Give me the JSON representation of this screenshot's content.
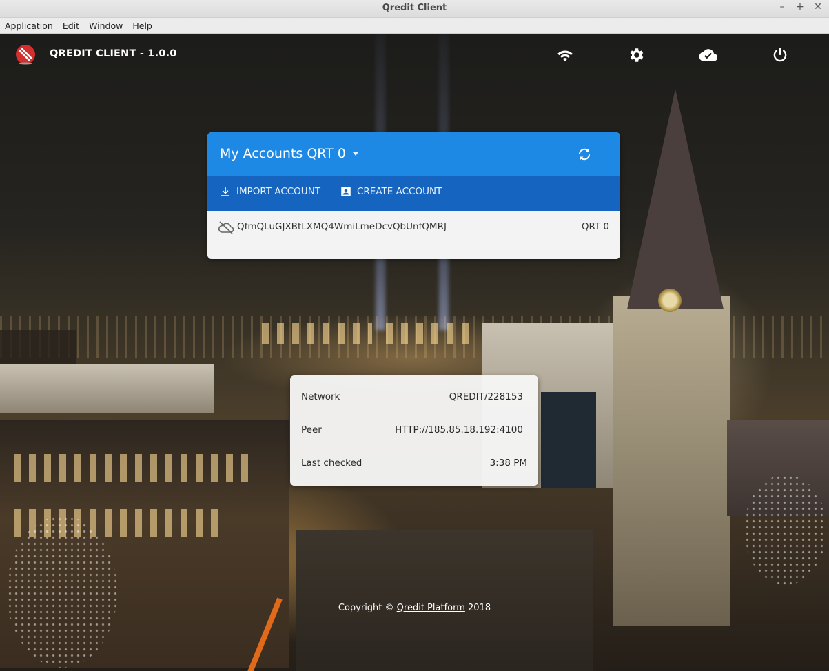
{
  "window": {
    "title": "Qredit Client",
    "controls": {
      "minimize": "–",
      "maximize": "+",
      "close": "✕"
    }
  },
  "menubar": {
    "items": [
      {
        "label": "Application"
      },
      {
        "label": "Edit"
      },
      {
        "label": "Window"
      },
      {
        "label": "Help"
      }
    ]
  },
  "header": {
    "app_title": "QREDIT CLIENT - 1.0.0",
    "icons": [
      "wifi-icon",
      "settings-icon",
      "cloud-check-icon",
      "power-icon"
    ]
  },
  "accounts": {
    "title": "My Accounts QRT 0",
    "import_label": "IMPORT ACCOUNT",
    "create_label": "CREATE ACCOUNT",
    "list": [
      {
        "address": "QfmQLuGJXBtLXMQ4WmiLmeDcvQbUnfQMRJ",
        "balance": "QRT 0"
      }
    ]
  },
  "network": {
    "network_label": "Network",
    "network_value": "QREDIT/228153",
    "peer_label": "Peer",
    "peer_value": "HTTP://185.85.18.192:4100",
    "checked_label": "Last checked",
    "checked_value": "3:38 PM"
  },
  "footer": {
    "copyright_prefix": "Copyright ©",
    "platform_link": "Qredit Platform",
    "year": "2018"
  },
  "colors": {
    "header_blue": "#1e88e5",
    "actions_blue": "#1565c0",
    "logo_red": "#d32f2f"
  }
}
